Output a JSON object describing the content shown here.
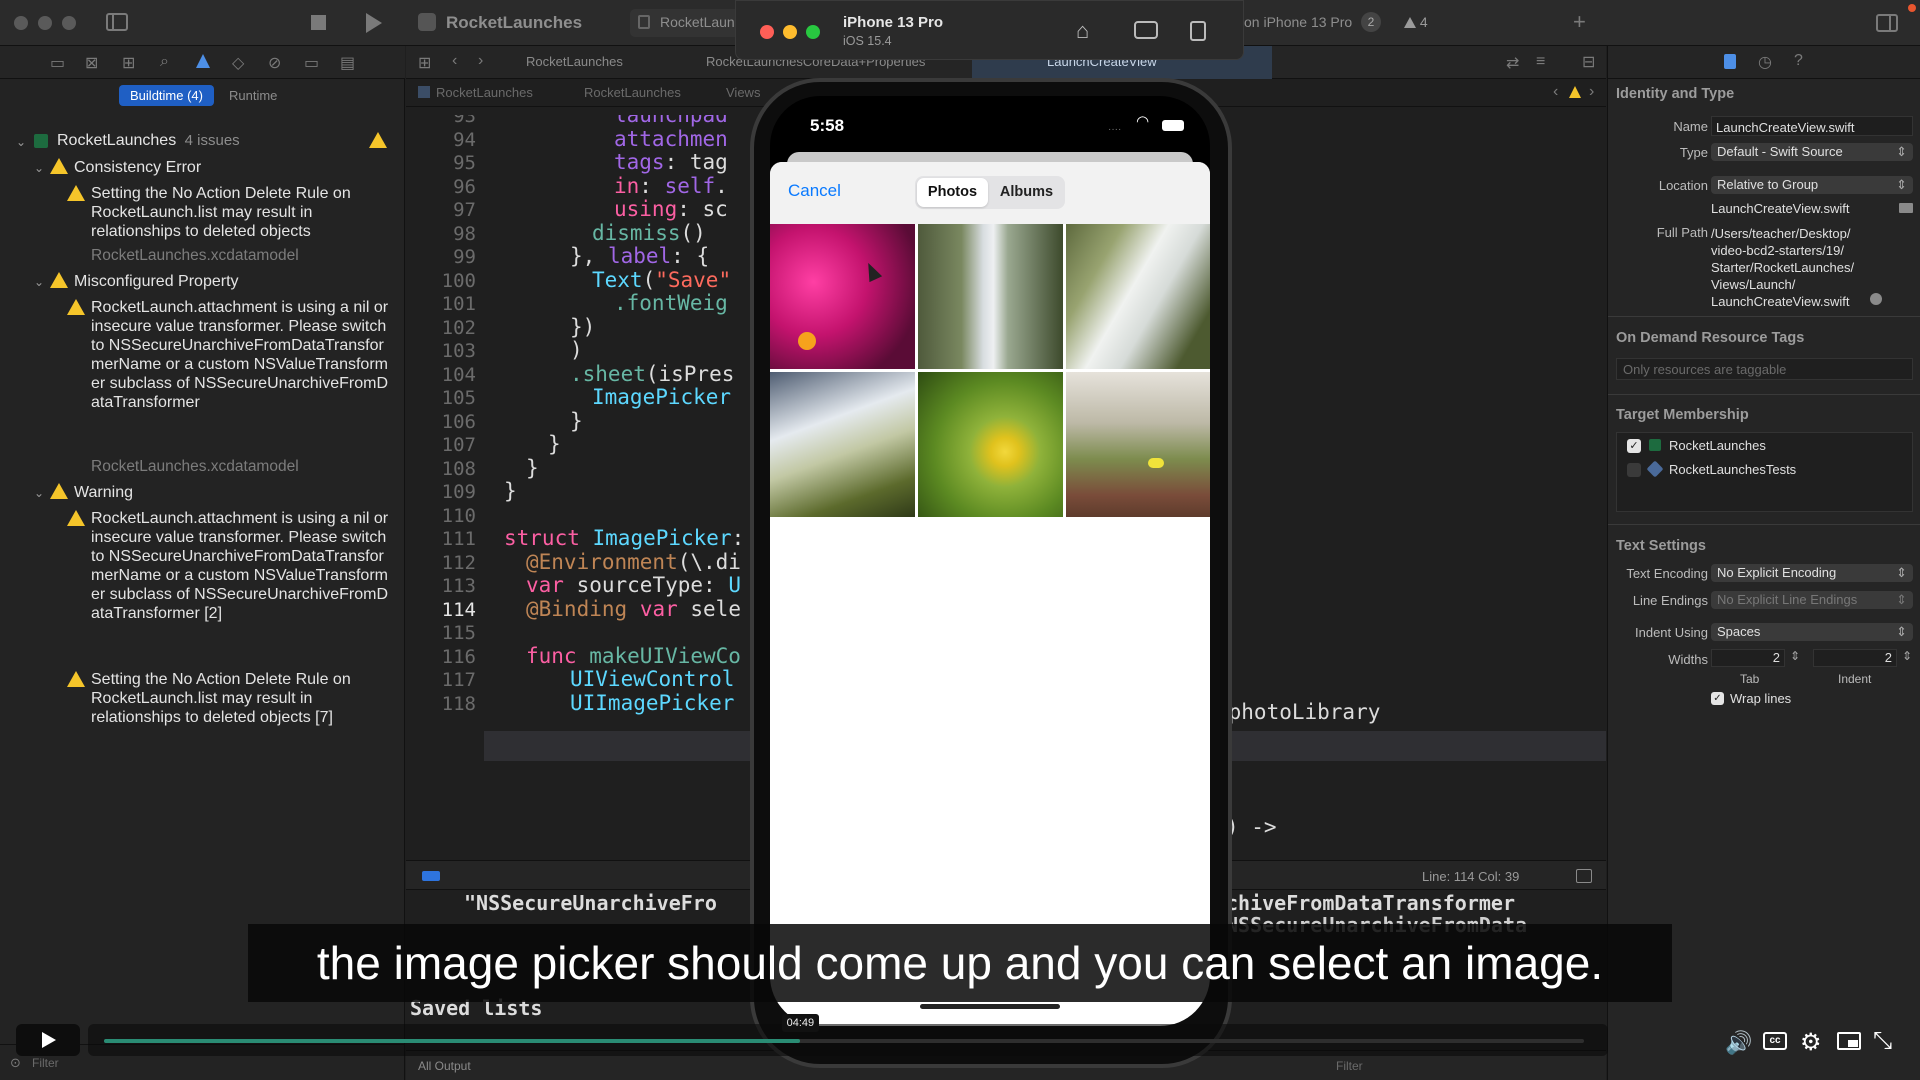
{
  "titlebar": {
    "project": "RocketLaunches",
    "tab_file": "RocketLaun",
    "run_dest": "on iPhone 13 Pro",
    "run_count": "2",
    "warn_count": "4"
  },
  "simulator": {
    "device": "iPhone 13 Pro",
    "os": "iOS 15.4",
    "time": "5:58",
    "cancel": "Cancel",
    "seg_photos": "Photos",
    "seg_albums": "Albums",
    "thumbs": [
      "flowers-photo",
      "waterfall-photo",
      "stream-photo",
      "cliff-waterfall-photo",
      "lemon-tree-photo",
      "meadow-photo"
    ]
  },
  "editor_jumpbar": {
    "breadcrumb1": "RocketLaunches",
    "breadcrumb2": "RocketLaunches",
    "breadcrumb3": "Views",
    "tab1": "RocketLaunches",
    "tab2": "RocketLaunchesCoreData+Properties",
    "tab3": "LaunchCreateView"
  },
  "navigator": {
    "seg_buildtime": "Buildtime (4)",
    "seg_runtime": "Runtime",
    "project": "RocketLaunches",
    "issue_count": "4 issues",
    "groups": [
      {
        "title": "Consistency Error",
        "items": [
          {
            "text": "Setting the No Action Delete Rule on RocketLaunch.list may result in relationships to deleted objects",
            "file": "RocketLaunches.xcdatamodel"
          }
        ]
      },
      {
        "title": "Misconfigured Property",
        "items": [
          {
            "text": "RocketLaunch.attachment is using a nil or insecure value transformer. Please switch to NSSecureUnarchiveFromDataTransformerName or a custom NSValueTransformer subclass of NSSecureUnarchiveFromDataTransformer",
            "file": "RocketLaunches.xcdatamodel"
          }
        ]
      },
      {
        "title": "Warning",
        "items": [
          {
            "text": "RocketLaunch.attachment is using a nil or insecure value transformer. Please switch to NSSecureUnarchiveFromDataTransformerName or a custom NSValueTransformer subclass of NSSecureUnarchiveFromDataTransformer [2]",
            "file": ""
          },
          {
            "text": "Setting the No Action Delete Rule on RocketLaunch.list may result in relationships to deleted objects [7]",
            "file": ""
          }
        ]
      }
    ],
    "filter_placeholder": "Filter"
  },
  "code": {
    "lines": [
      {
        "n": "93",
        "t": "launchpad"
      },
      {
        "n": "94",
        "t": "attachmen"
      },
      {
        "n": "95",
        "t": "tags: tag"
      },
      {
        "n": "96",
        "t": "in: self."
      },
      {
        "n": "97",
        "t": "using: sc"
      },
      {
        "n": "98",
        "t": "dismiss()"
      },
      {
        "n": "99",
        "t": "}, label: {"
      },
      {
        "n": "100",
        "t": "Text(\"Save\""
      },
      {
        "n": "101",
        "t": ".fontWeig"
      },
      {
        "n": "102",
        "t": "})"
      },
      {
        "n": "103",
        "t": ")"
      },
      {
        "n": "104",
        "t": ".sheet(isPres"
      },
      {
        "n": "105",
        "t": "ImagePicker"
      },
      {
        "n": "106",
        "t": "}"
      },
      {
        "n": "107",
        "t": "}"
      },
      {
        "n": "108",
        "t": "}"
      },
      {
        "n": "109",
        "t": "}"
      },
      {
        "n": "110",
        "t": ""
      },
      {
        "n": "111",
        "t": "struct ImagePicker:"
      },
      {
        "n": "112",
        "t": "@Environment(\\.di"
      },
      {
        "n": "113",
        "t": "var sourceType: U"
      },
      {
        "n": "114",
        "t": "@Binding var sele"
      },
      {
        "n": "115",
        "t": ""
      },
      {
        "n": "116",
        "t": "func makeUIViewCo"
      },
      {
        "n": "117",
        "t": "UIViewControl"
      },
      {
        "n": "118",
        "t": "UIImagePicker"
      }
    ],
    "right_113": ".photoLibrary",
    "right_116": ") ->",
    "status": "Line: 114  Col: 39"
  },
  "console": {
    "line1_left": "\"NSSecureUnarchiveFro",
    "line1_right": "chiveFromDataTransformer",
    "line2_right": "NSSecureUnarchiveFromData",
    "line3": "Saved lists",
    "output_label": "All Output",
    "filter_placeholder": "Filter"
  },
  "inspector": {
    "section_identity": "Identity and Type",
    "name_label": "Name",
    "name_value": "LaunchCreateView.swift",
    "type_label": "Type",
    "type_value": "Default - Swift Source",
    "location_label": "Location",
    "location_value": "Relative to Group",
    "location_file": "LaunchCreateView.swift",
    "fullpath_label": "Full Path",
    "fullpath_lines": [
      "/Users/teacher/Desktop/",
      "video-bcd2-starters/19/",
      "Starter/RocketLaunches/",
      "Views/Launch/",
      "LaunchCreateView.swift"
    ],
    "section_odr": "On Demand Resource Tags",
    "odr_placeholder": "Only resources are taggable",
    "section_target": "Target Membership",
    "targets": [
      {
        "name": "RocketLaunches",
        "checked": true
      },
      {
        "name": "RocketLaunchesTests",
        "checked": false
      }
    ],
    "section_text": "Text Settings",
    "encoding_label": "Text Encoding",
    "encoding_value": "No Explicit Encoding",
    "endings_label": "Line Endings",
    "endings_value": "No Explicit Line Endings",
    "indent_label": "Indent Using",
    "indent_value": "Spaces",
    "widths_label": "Widths",
    "tab_width": "2",
    "indent_width": "2",
    "tab_caption": "Tab",
    "indent_caption": "Indent",
    "wrap_label": "Wrap lines"
  },
  "caption": "the image picker should come up and you can select an image.",
  "player": {
    "time_tooltip": "04:49",
    "progress": 0.47
  }
}
